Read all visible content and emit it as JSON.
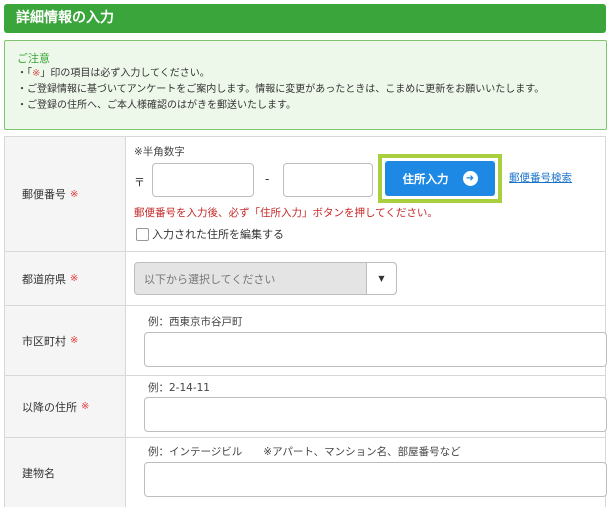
{
  "header": {
    "title": "詳細情報の入力"
  },
  "notice": {
    "title": "ご注意",
    "line1_pre": "・「",
    "line1_mark": "※",
    "line1_post": "」印の項目は必ず入力してください。",
    "line2": "・ご登録情報に基づいてアンケートをご案内します。情報に変更があったときは、こまめに更新をお願いいたします。",
    "line3": "・ご登録の住所へ、ご本人様確認のはがきを郵送いたします。"
  },
  "required_mark": "※",
  "postal": {
    "label": "郵便番号",
    "hint": "※半角数字",
    "symbol": "〒",
    "separator": "-",
    "first_value": "",
    "second_value": "",
    "address_button": "住所入力",
    "lookup_link": "郵便番号検索",
    "warning": "郵便番号を入力後、必ず「住所入力」ボタンを押してください。",
    "edit_checkbox_label": "入力された住所を編集する"
  },
  "prefecture": {
    "label": "都道府県",
    "placeholder": "以下から選択してください"
  },
  "city": {
    "label": "市区町村",
    "hint": "例：西東京市谷戸町",
    "value": ""
  },
  "street": {
    "label": "以降の住所",
    "hint": "例：2-14-11",
    "value": ""
  },
  "building": {
    "label": "建物名",
    "hint": "例：インテージビル　　※アパート、マンション名、部屋番号など",
    "value": ""
  },
  "colors": {
    "header_green": "#3aa53a",
    "notice_bg": "#eef8ea",
    "required_red": "#e04040",
    "button_blue": "#1e88e5",
    "highlight_lime": "#a9cf3f",
    "link_blue": "#1a73c9"
  },
  "icons": {
    "address_button_icon": "arrow-right-circle-icon",
    "select_icon": "caret-down-icon"
  }
}
